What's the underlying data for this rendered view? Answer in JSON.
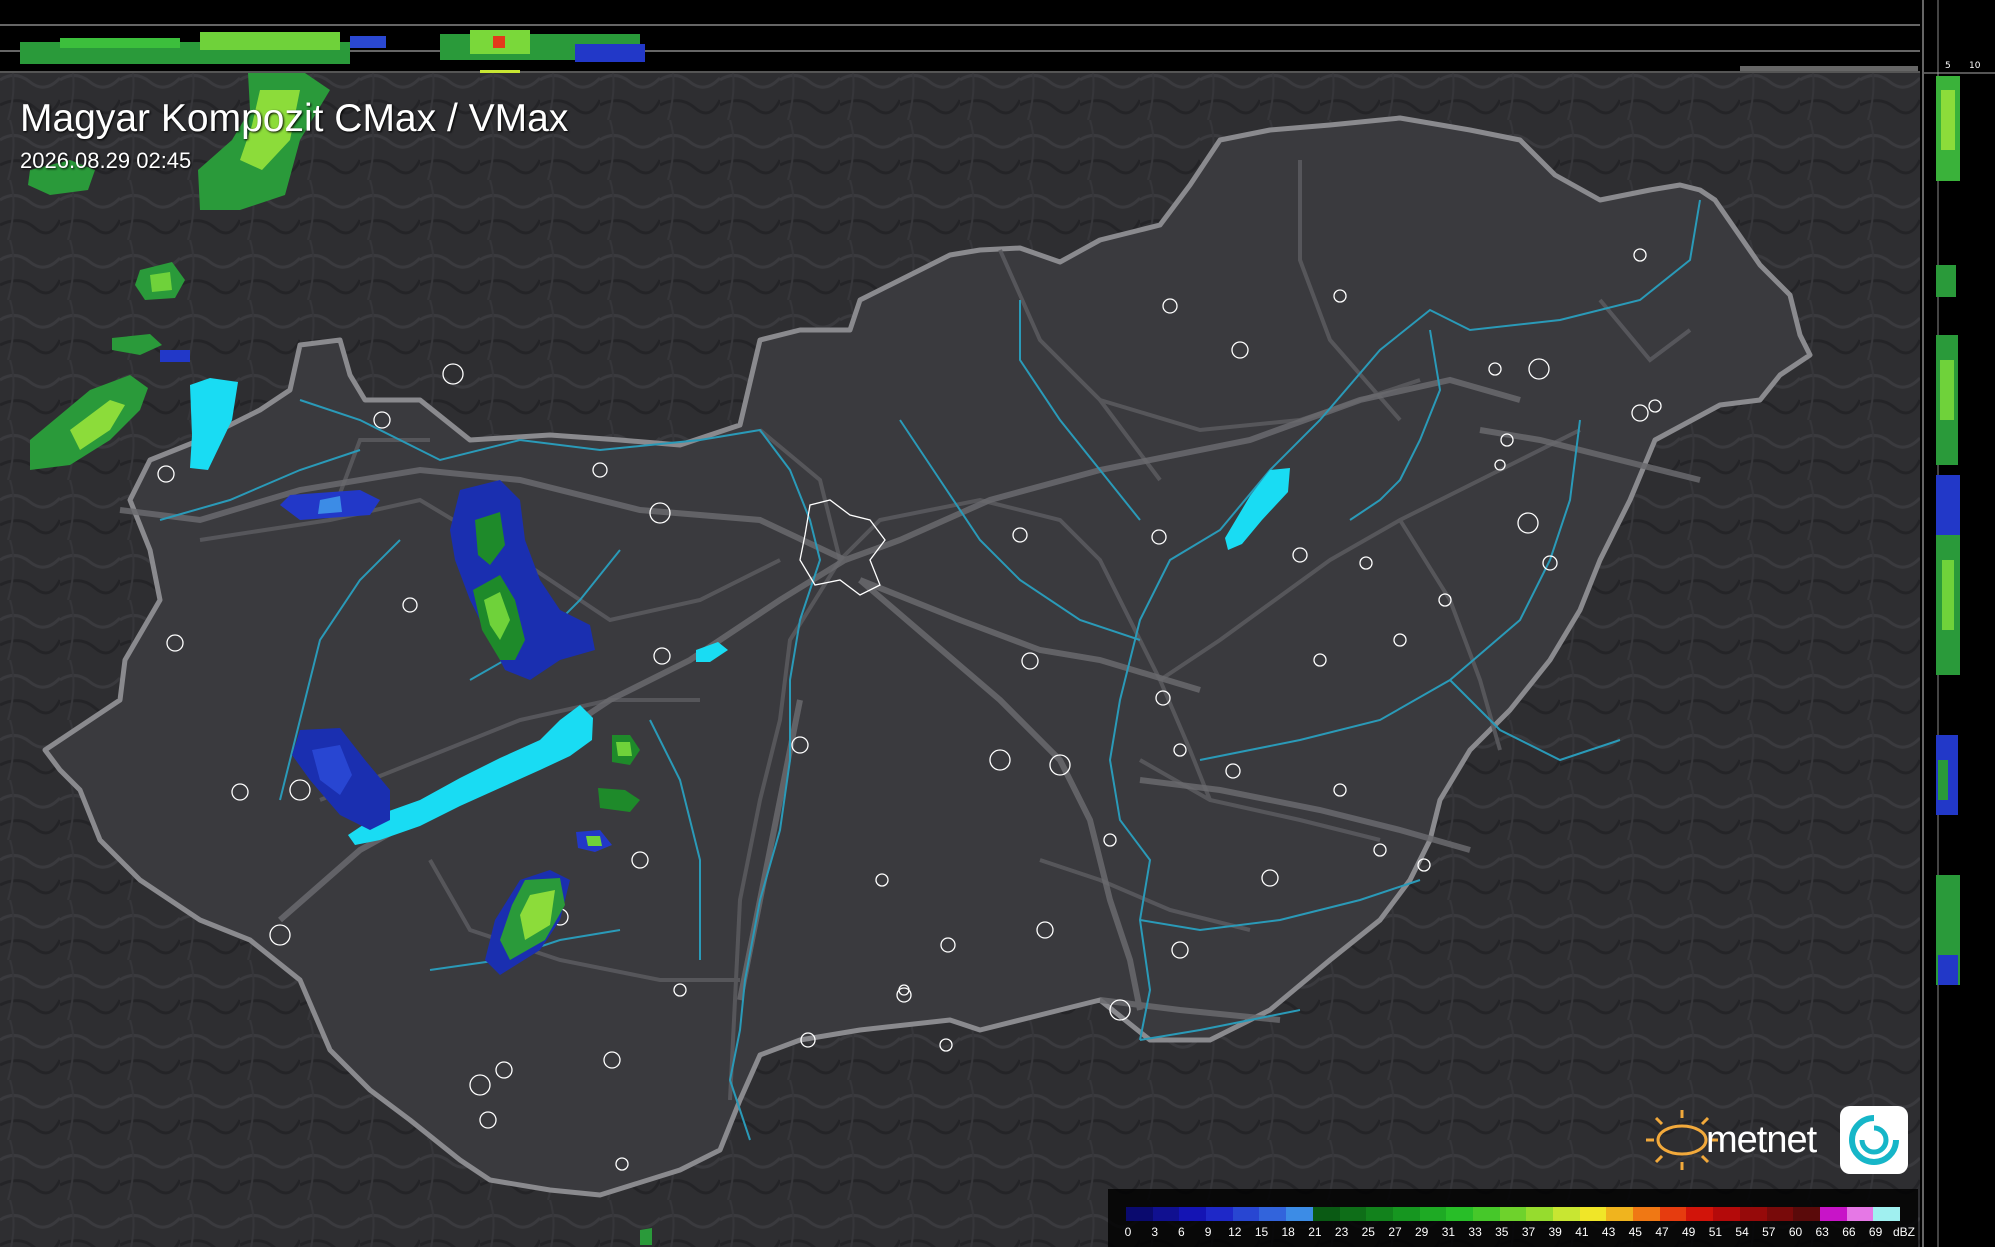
{
  "map": {
    "title": "Magyar Kompozit CMax / VMax",
    "timestamp": "2026.08.29 02:45",
    "logo_text": "metnet",
    "icons": [
      "sun-logo-icon",
      "cloud-swirl-logo-icon"
    ]
  },
  "vertical_profile": {
    "top_ticks": [
      "10",
      "5"
    ],
    "side_ticks": [
      "5",
      "10"
    ]
  },
  "legend": {
    "unit": "dBZ",
    "labels": [
      "0",
      "3",
      "6",
      "9",
      "12",
      "15",
      "18",
      "21",
      "23",
      "25",
      "27",
      "29",
      "31",
      "33",
      "35",
      "37",
      "39",
      "41",
      "43",
      "45",
      "47",
      "49",
      "51",
      "54",
      "57",
      "60",
      "63",
      "66",
      "69"
    ],
    "colors": [
      "#0a0a6e",
      "#101090",
      "#1414b4",
      "#1e28c8",
      "#2846d2",
      "#3264dc",
      "#3c8ce6",
      "#0a5a14",
      "#0e6e18",
      "#12821c",
      "#169620",
      "#1eaa24",
      "#28be28",
      "#46c82a",
      "#6ed22c",
      "#96dc2e",
      "#c8e632",
      "#f0e628",
      "#f0b41e",
      "#f07814",
      "#e63c0f",
      "#d2140a",
      "#b40a0a",
      "#960a0a",
      "#780a0a",
      "#5a0a0a",
      "#c814c8",
      "#e678e6",
      "#a0f0f0"
    ]
  }
}
